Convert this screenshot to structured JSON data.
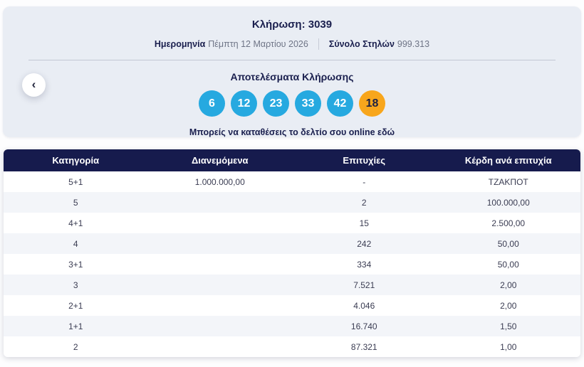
{
  "colors": {
    "panel_bg": "#e9edf4",
    "navy": "#1a1f4e",
    "ball_blue": "#26a9e0",
    "ball_orange": "#f8a61c",
    "table_header_bg": "#161b4d",
    "row_alt_bg": "#f3f5f9"
  },
  "header": {
    "draw_title": "Κλήρωση: 3039",
    "date_label": "Ημερομηνία",
    "date_value": "Πέμπτη 12 Μαρτίου 2026",
    "columns_label": "Σύνολο Στηλών",
    "columns_value": "999.313",
    "results_title": "Αποτελέσματα Κλήρωσης",
    "online_text": "Μπορείς να καταθέσεις το δελτίο σου online εδώ",
    "back_icon": "‹"
  },
  "draw": {
    "numbers": [
      "6",
      "12",
      "23",
      "33",
      "42"
    ],
    "bonus_number": "18"
  },
  "table": {
    "headers": [
      "Κατηγορία",
      "Διανεμόμενα",
      "Επιτυχίες",
      "Κέρδη ανά επιτυχία"
    ],
    "rows": [
      [
        "5+1",
        "1.000.000,00",
        "-",
        "ΤΖΑΚΠΟΤ"
      ],
      [
        "5",
        "",
        "2",
        "100.000,00"
      ],
      [
        "4+1",
        "",
        "15",
        "2.500,00"
      ],
      [
        "4",
        "",
        "242",
        "50,00"
      ],
      [
        "3+1",
        "",
        "334",
        "50,00"
      ],
      [
        "3",
        "",
        "7.521",
        "2,00"
      ],
      [
        "2+1",
        "",
        "4.046",
        "2,00"
      ],
      [
        "1+1",
        "",
        "16.740",
        "1,50"
      ],
      [
        "2",
        "",
        "87.321",
        "1,00"
      ]
    ]
  }
}
